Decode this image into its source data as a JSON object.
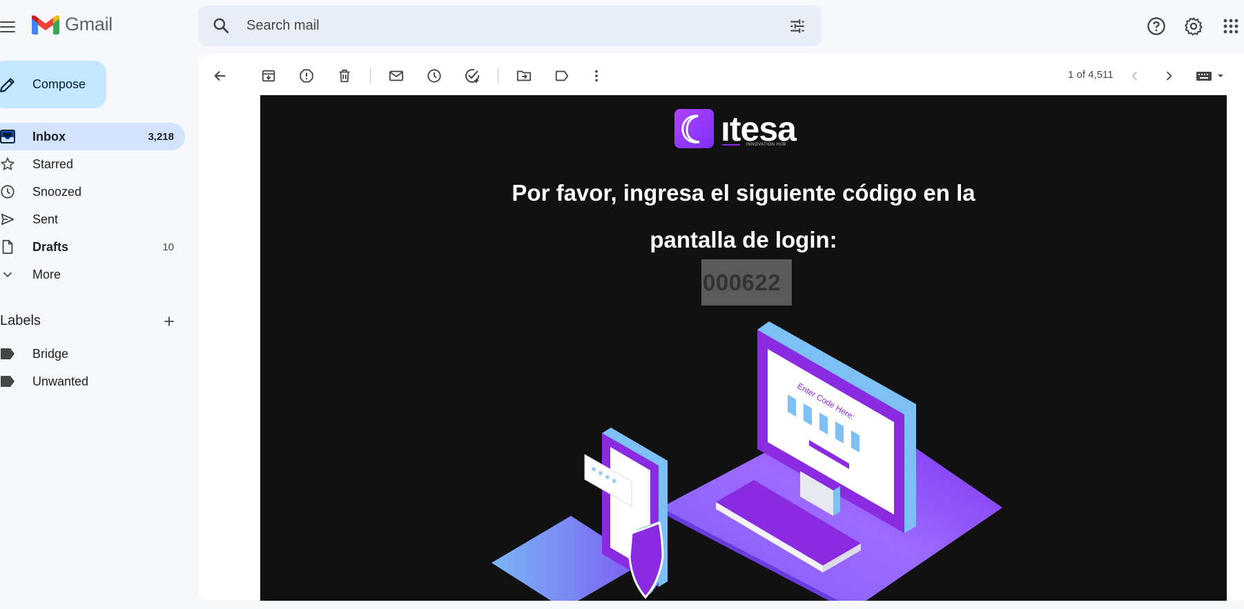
{
  "app": {
    "name": "Gmail"
  },
  "search": {
    "placeholder": "Search mail"
  },
  "sidebar": {
    "compose_label": "Compose",
    "items": [
      {
        "label": "Inbox",
        "count": "3,218",
        "icon": "inbox-icon",
        "active": true,
        "bold": true
      },
      {
        "label": "Starred",
        "count": "",
        "icon": "star-icon"
      },
      {
        "label": "Snoozed",
        "count": "",
        "icon": "clock-icon"
      },
      {
        "label": "Sent",
        "count": "",
        "icon": "send-icon"
      },
      {
        "label": "Drafts",
        "count": "10",
        "icon": "draft-icon",
        "bold": true
      },
      {
        "label": "More",
        "count": "",
        "icon": "chevron-down-icon"
      }
    ],
    "labels_title": "Labels",
    "labels": [
      {
        "label": "Bridge",
        "icon": "label-icon"
      },
      {
        "label": "Unwanted",
        "icon": "label-icon"
      }
    ]
  },
  "toolbar": {
    "pager": "1 of 4,511",
    "icons": [
      "back-arrow-icon",
      "archive-icon",
      "report-spam-icon",
      "delete-icon",
      "mark-unread-icon",
      "snooze-icon",
      "add-task-icon",
      "move-to-icon",
      "label-icon",
      "more-vert-icon",
      "newer-icon",
      "older-icon",
      "keyboard-icon"
    ]
  },
  "email": {
    "brand_name": "ıtesa",
    "brand_sub": "INNOVATION HUB",
    "message_line1": "Por favor, ingresa el siguiente código en la",
    "message_line2": "pantalla de login:",
    "code": "000622",
    "illustration_text": "Enter Code Here:",
    "illustration_password": "* * * *"
  },
  "colors": {
    "accent": "#c2e7ff",
    "active_nav": "#d3e3fd",
    "search_bg": "#e9eef6",
    "page_bg": "#f6f8fc",
    "email_bg": "#111111",
    "brand_purple": "#8a2be2",
    "brand_blue": "#74b9f5"
  }
}
